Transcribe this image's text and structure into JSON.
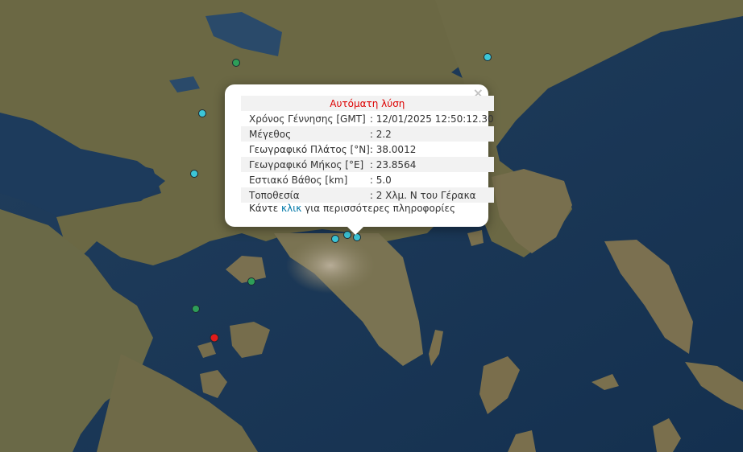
{
  "popup": {
    "title": "Αυτόματη λύση",
    "close_symbol": "×",
    "rows": [
      {
        "label": "Χρόνος Γέννησης [GMT]",
        "value": ": 12/01/2025 12:50:12.30"
      },
      {
        "label": "Μέγεθος",
        "value": ": 2.2"
      },
      {
        "label": "Γεωγραφικό Πλάτος [°N]",
        "value": ": 38.0012"
      },
      {
        "label": "Γεωγραφικό Μήκος [°E]",
        "value": ": 23.8564"
      },
      {
        "label": "Εστιακό Βάθος [km]",
        "value": ": 5.0"
      },
      {
        "label": "Τοποθεσία",
        "value": ": 2 Χλμ. Ν του Γέρακα"
      }
    ],
    "more_prefix": "Κάντε ",
    "more_link": "κλικ",
    "more_suffix": " για περισσότερες πληροφορίες"
  },
  "colors": {
    "sea": "#1b3a5a",
    "land": "#6e6a45",
    "marker_recent": "#3cc6d8",
    "marker_older": "#2e9e58",
    "marker_latest": "#e21b1b"
  }
}
